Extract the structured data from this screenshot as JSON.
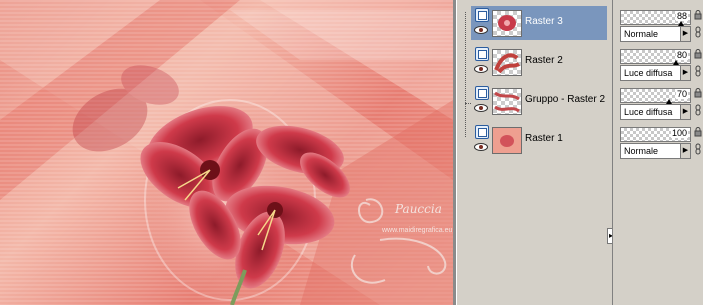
{
  "layers": [
    {
      "name": "Raster 3",
      "selected": true,
      "visibility_icon": "eye-icon",
      "kind_icon": "raster-layer-icon"
    },
    {
      "name": "Raster 2",
      "selected": false,
      "visibility_icon": "eye-icon",
      "kind_icon": "raster-layer-icon"
    },
    {
      "name": "Gruppo - Raster 2",
      "selected": false,
      "visibility_icon": "eye-icon",
      "kind_icon": "raster-layer-icon"
    },
    {
      "name": "Raster 1",
      "selected": false,
      "visibility_icon": "eye-icon",
      "kind_icon": "raster-layer-icon"
    }
  ],
  "layer_props": [
    {
      "opacity": "88",
      "opacity_level": 0.88,
      "blend_mode": "Normale"
    },
    {
      "opacity": "80",
      "opacity_level": 0.8,
      "blend_mode": "Luce diffusa"
    },
    {
      "opacity": "70",
      "opacity_level": 0.7,
      "blend_mode": "Luce diffusa"
    },
    {
      "opacity": "100",
      "opacity_level": 1.0,
      "blend_mode": "Normale"
    }
  ],
  "watermark": {
    "signature": "Pauccia",
    "url": "www.maidiregrafica.eu"
  },
  "colors": {
    "selection": "#7a96bd",
    "panel": "#d4d0c8",
    "artwork_base": "#e98a7e",
    "flower": "#c83a4a"
  }
}
